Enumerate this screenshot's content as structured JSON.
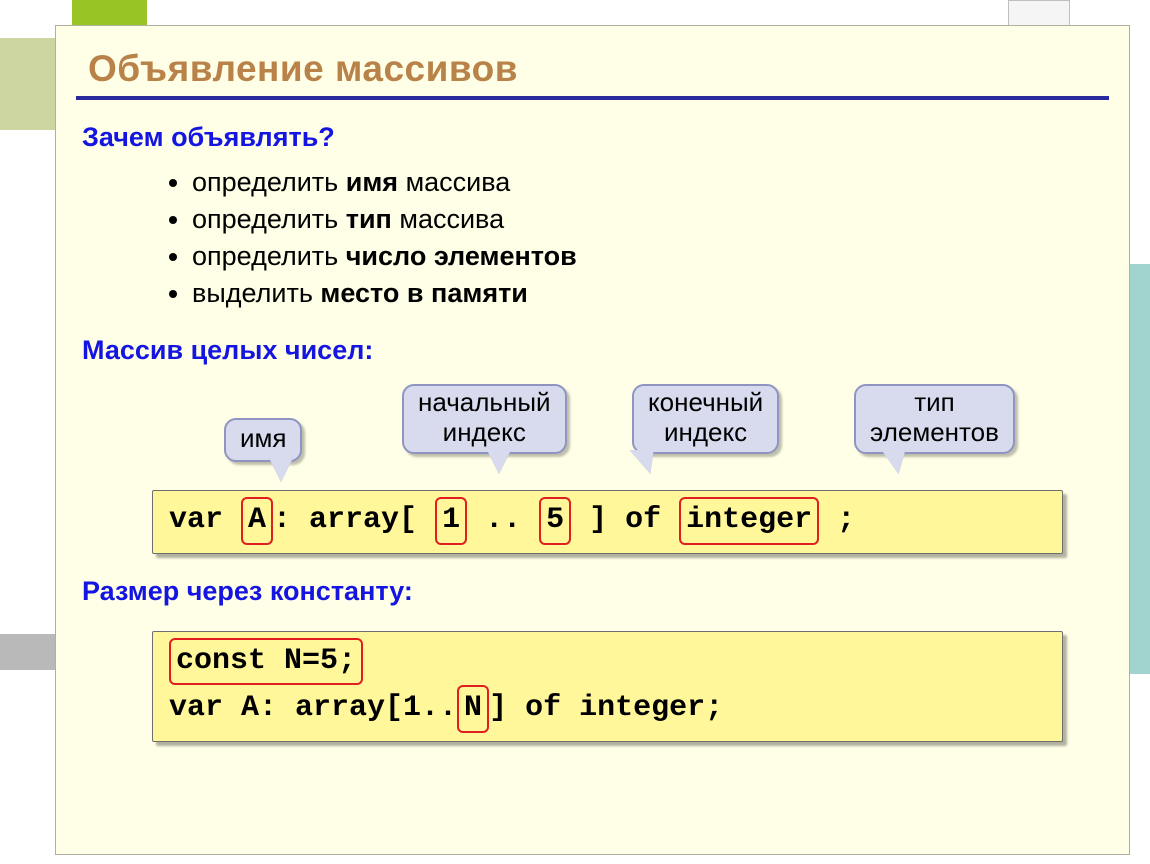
{
  "title": "Объявление массивов",
  "sections": {
    "why": {
      "heading": "Зачем объявлять?",
      "b1_pre": "определить ",
      "b1_bold": "имя",
      "b1_post": " массива",
      "b2_pre": "определить ",
      "b2_bold": "тип",
      "b2_post": " массива",
      "b3_pre": "определить ",
      "b3_bold": "число элементов",
      "b3_post": "",
      "b4_pre": "выделить ",
      "b4_bold": "место в памяти",
      "b4_post": ""
    },
    "int_array": {
      "heading": "Массив целых чисел:",
      "callouts": {
        "name": "имя",
        "start_index_l1": "начальный",
        "start_index_l2": "индекс",
        "end_index_l1": "конечный",
        "end_index_l2": "индекс",
        "elem_type_l1": "тип",
        "elem_type_l2": "элементов"
      },
      "code": {
        "p1": "var ",
        "hl1": "A",
        "p2": ": array[ ",
        "hl2": "1",
        "p3": " .. ",
        "hl3": "5",
        "p4": " ] of ",
        "hl4": "integer",
        "p5": " ;"
      }
    },
    "const_size": {
      "heading": "Размер через константу:",
      "code": {
        "line1_hl": "const N=5;",
        "line2_p1": "var A: array[1..",
        "line2_hl": " N ",
        "line2_p2": "] of integer;"
      }
    }
  }
}
